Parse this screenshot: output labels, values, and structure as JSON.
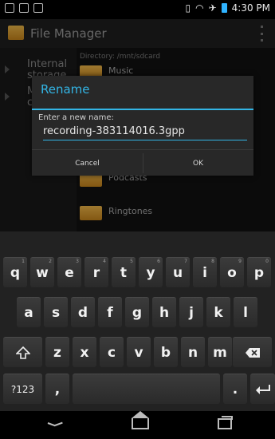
{
  "status_bar": {
    "time": "4:30 PM",
    "battery_color": "#2fb3ff"
  },
  "action_bar": {
    "title": "File Manager"
  },
  "nav": {
    "items": [
      {
        "label": "Internal\nstorage"
      },
      {
        "label": "M\nc"
      }
    ]
  },
  "content": {
    "directory": "Directory: /mnt/sdcard",
    "folders": [
      {
        "label": "Music"
      },
      {
        "label": "Podcasts"
      },
      {
        "label": "Ringtones"
      }
    ]
  },
  "dialog": {
    "title": "Rename",
    "prompt": "Enter a new name:",
    "value": "recording-383114016.3gpp",
    "cancel": "Cancel",
    "ok": "OK",
    "accent": "#33b5e5"
  },
  "keyboard": {
    "row1": [
      {
        "k": "q",
        "h": "1"
      },
      {
        "k": "w",
        "h": "2"
      },
      {
        "k": "e",
        "h": "3"
      },
      {
        "k": "r",
        "h": "4"
      },
      {
        "k": "t",
        "h": "5"
      },
      {
        "k": "y",
        "h": "6"
      },
      {
        "k": "u",
        "h": "7"
      },
      {
        "k": "i",
        "h": "8"
      },
      {
        "k": "o",
        "h": "9"
      },
      {
        "k": "p",
        "h": "0"
      }
    ],
    "row2": [
      "a",
      "s",
      "d",
      "f",
      "g",
      "h",
      "j",
      "k",
      "l"
    ],
    "row3": [
      "z",
      "x",
      "c",
      "v",
      "b",
      "n",
      "m"
    ],
    "symbols": "?123",
    "comma": ",",
    "period": ".",
    "shift_icon": "shift-icon",
    "delete_icon": "backspace-icon",
    "enter_icon": "enter-icon"
  }
}
